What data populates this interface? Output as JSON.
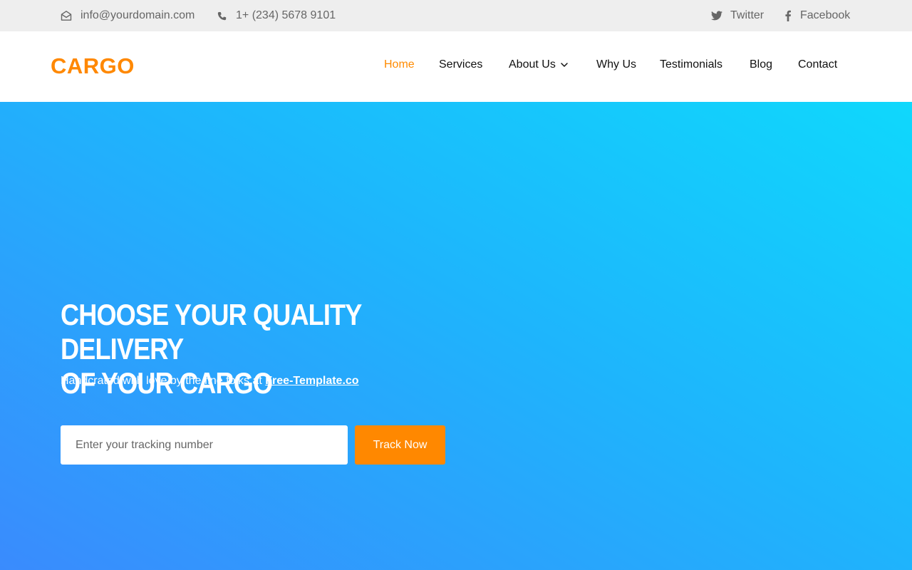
{
  "topbar": {
    "email": "info@yourdomain.com",
    "phone": "1+ (234) 5678 9101",
    "twitter": "Twitter",
    "facebook": "Facebook"
  },
  "brand": {
    "logo": "CARGO"
  },
  "nav": {
    "items": [
      {
        "label": "Home",
        "active": true
      },
      {
        "label": "Services"
      },
      {
        "label": "About Us",
        "dropdown": true
      },
      {
        "label": "Why Us"
      },
      {
        "label": "Testimonials"
      },
      {
        "label": "Blog"
      },
      {
        "label": "Contact"
      }
    ]
  },
  "hero": {
    "title_line1": "CHOOSE YOUR QUALITY DELIVERY",
    "title_line2": "OF YOUR CARGO",
    "subtitle_prefix": "Handcrated with love by the fine folks at ",
    "subtitle_link": "Free-Template.co",
    "tracking_placeholder": "Enter your tracking number",
    "track_button": "Track Now"
  },
  "colors": {
    "accent": "#ff8800",
    "topbar_bg": "#eeeeee",
    "hero_gradient_start": "#3a8bfd",
    "hero_gradient_end": "#0fd8fc"
  },
  "icons": {
    "email": "envelope-open-icon",
    "phone": "phone-icon",
    "twitter": "twitter-icon",
    "facebook": "facebook-icon",
    "dropdown": "chevron-down-icon"
  }
}
